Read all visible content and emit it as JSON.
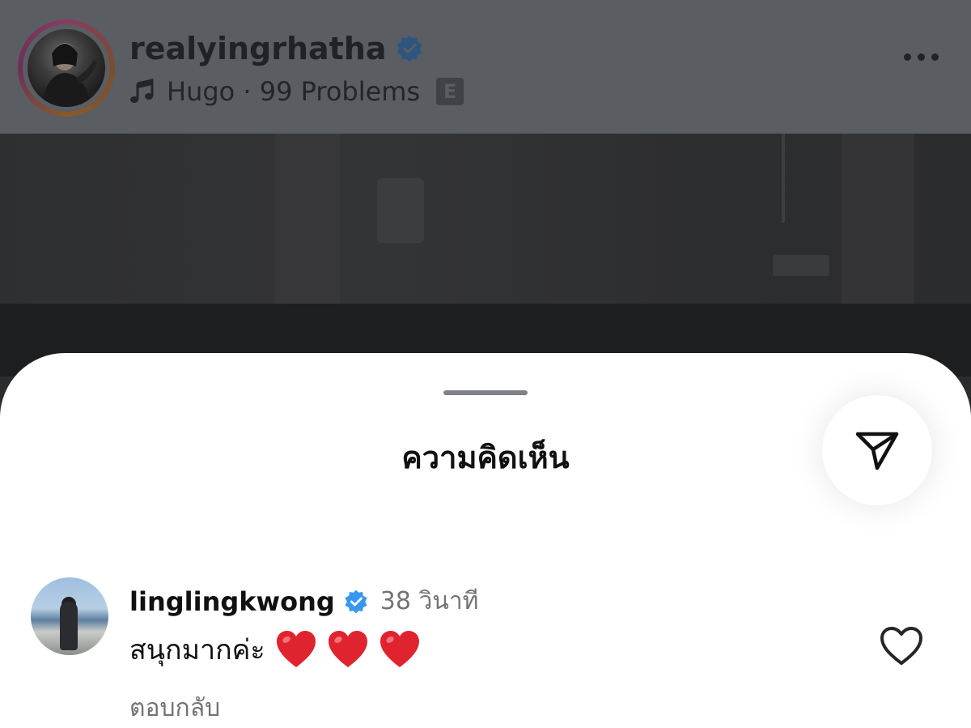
{
  "post": {
    "username": "realyingrhatha",
    "music": "Hugo · 99 Problems",
    "explicit_badge": "E"
  },
  "sheet": {
    "title": "ความคิดเห็น"
  },
  "comment": {
    "username": "linglingkwong",
    "time": "38 วินาที",
    "text": "สนุกมากค่ะ",
    "reply_label": "ตอบกลับ"
  },
  "colors": {
    "verified": "#3897f0",
    "heart": "#e0242f",
    "muted_text": "#737373"
  }
}
